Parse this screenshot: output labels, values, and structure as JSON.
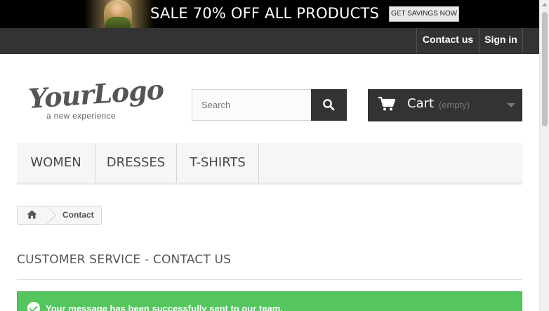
{
  "promo": {
    "headline": "SALE 70% OFF ALL PRODUCTS",
    "cta_label": "GET SAVINGS NOW"
  },
  "topnav": {
    "contact_label": "Contact us",
    "signin_label": "Sign in"
  },
  "logo": {
    "main": "YourLogo",
    "tagline": "a new experience"
  },
  "search": {
    "placeholder": "Search",
    "value": "",
    "button_icon": "search-icon"
  },
  "cart": {
    "icon": "cart-icon",
    "label": "Cart",
    "state": "(empty)"
  },
  "menu": {
    "items": [
      "WOMEN",
      "DRESSES",
      "T-SHIRTS"
    ]
  },
  "breadcrumb": {
    "home_icon": "home-icon",
    "current": "Contact"
  },
  "page": {
    "heading": "CUSTOMER SERVICE - CONTACT US"
  },
  "alert": {
    "message": "Your message has been successfully sent to our team.",
    "color": "#55c65e"
  },
  "colors": {
    "dark_bar": "#333333",
    "menu_bg": "#f6f6f6",
    "success": "#55c65e"
  }
}
